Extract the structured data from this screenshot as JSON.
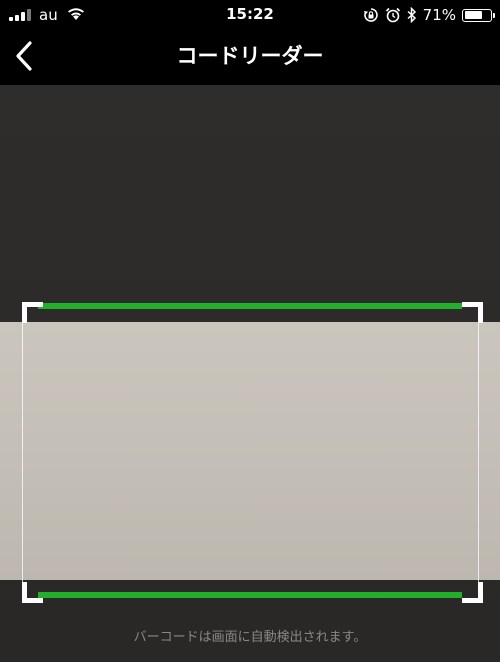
{
  "status_bar": {
    "carrier": "au",
    "time": "15:22",
    "battery_percent": "71%",
    "battery_level": 0.71,
    "icons": [
      "signal-icon",
      "wifi-icon",
      "rotation-lock-icon",
      "alarm-icon",
      "bluetooth-icon",
      "battery-icon"
    ]
  },
  "nav": {
    "title": "コードリーダー",
    "back_icon": "chevron-left-icon"
  },
  "scanner": {
    "frame_color": "#ffffff",
    "scan_line_color": "#22b02c",
    "hint": "バーコードは画面に自動検出されます。"
  }
}
